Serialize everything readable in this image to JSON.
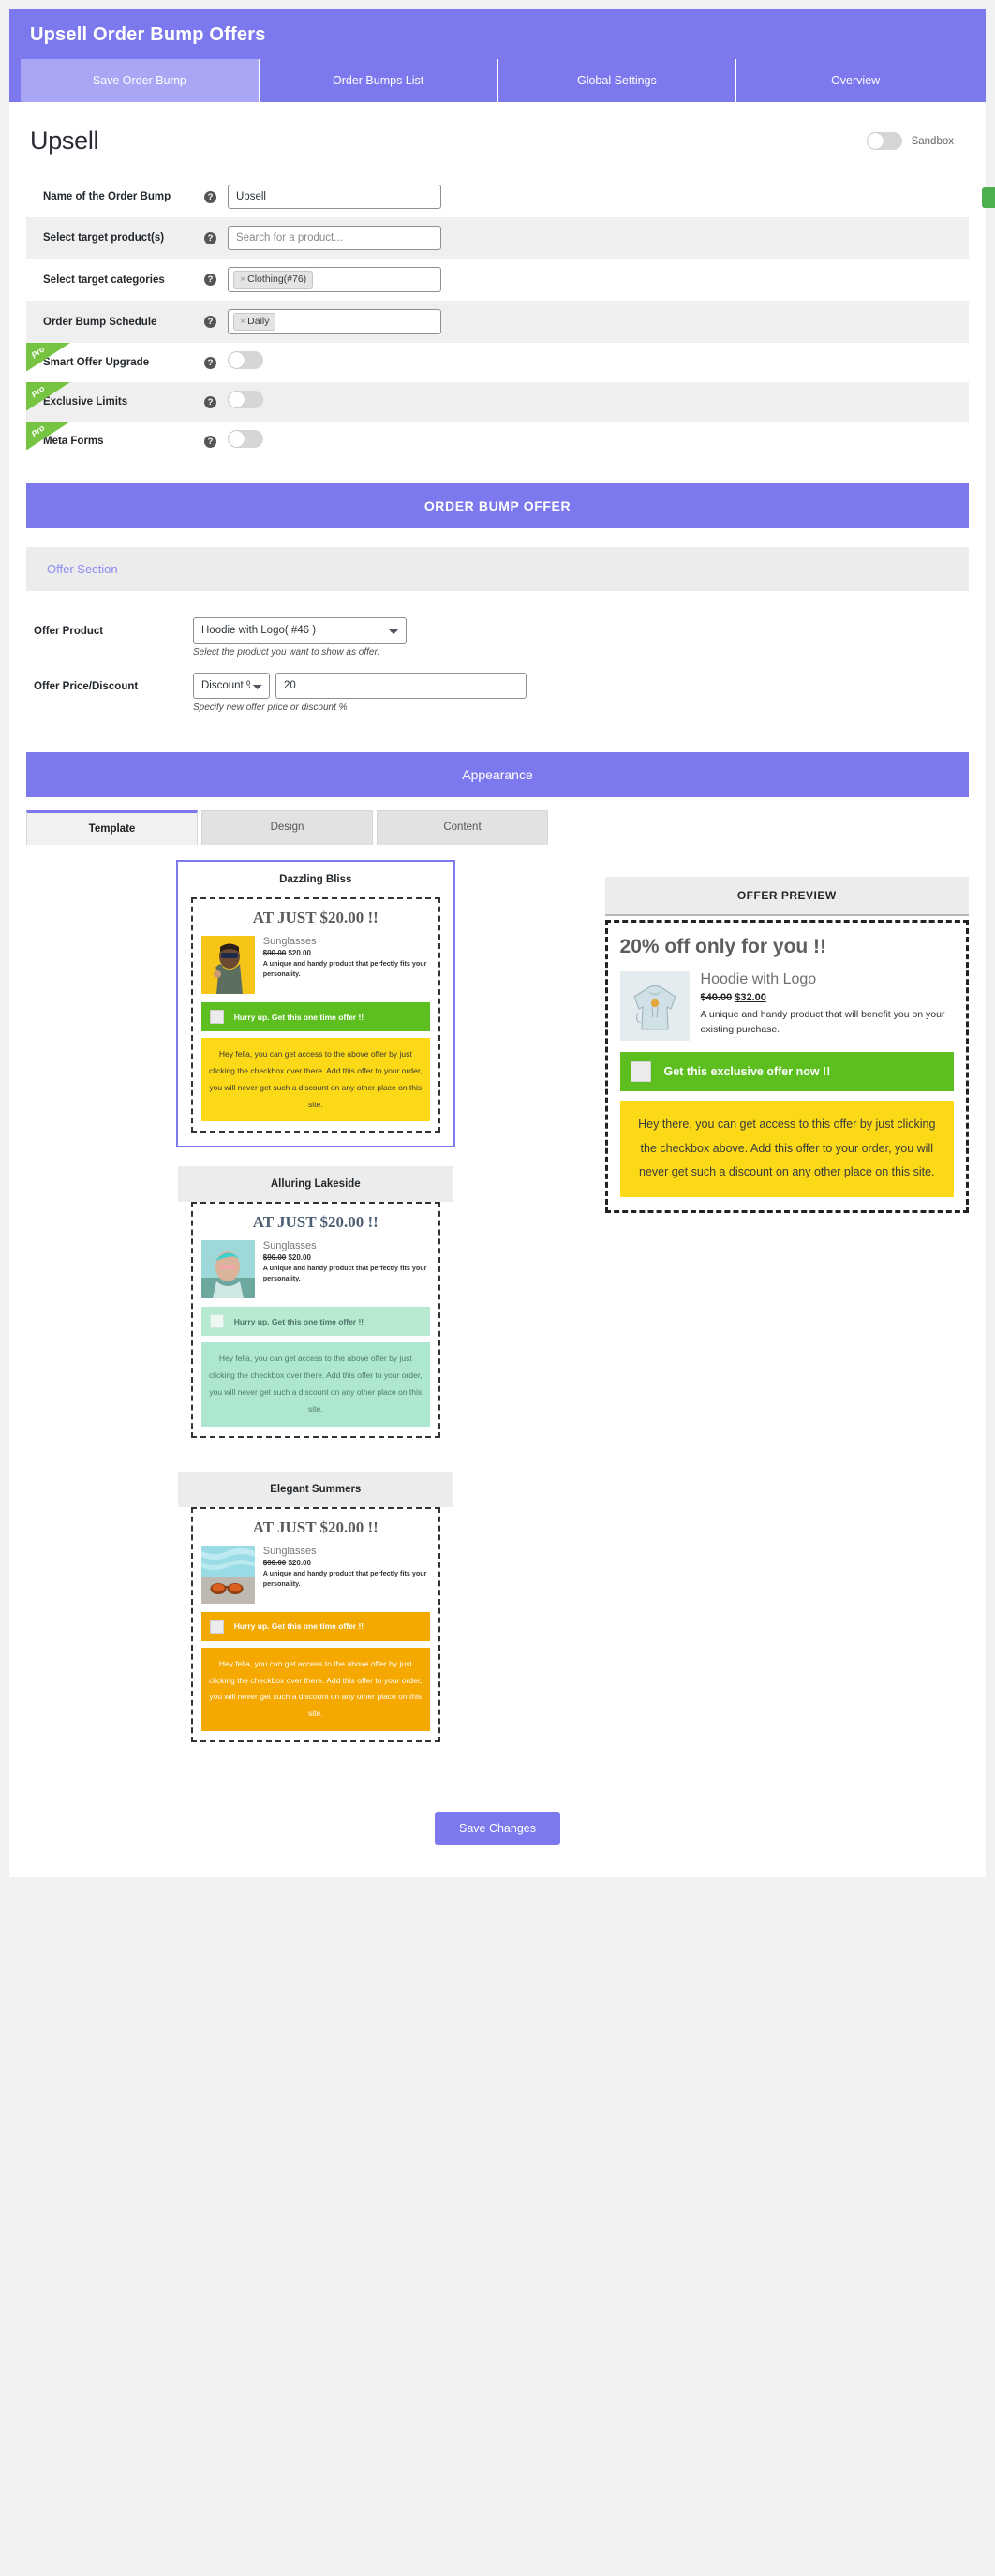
{
  "header": {
    "app_title": "Upsell Order Bump Offers",
    "tabs": [
      {
        "label": "Save Order Bump",
        "active": true
      },
      {
        "label": "Order Bumps List",
        "active": false
      },
      {
        "label": "Global Settings",
        "active": false
      },
      {
        "label": "Overview",
        "active": false
      }
    ]
  },
  "page": {
    "title": "Upsell",
    "sandbox_label": "Sandbox",
    "sandbox_on": false
  },
  "form": {
    "rows": [
      {
        "label": "Name of the Order Bump",
        "type": "text",
        "value": "Upsell",
        "placeholder": "",
        "help": "?"
      },
      {
        "label": "Select target product(s)",
        "type": "text",
        "value": "",
        "placeholder": "Search for a product...",
        "help": "?"
      },
      {
        "label": "Select target categories",
        "type": "token",
        "token": "Clothing(#76)",
        "token_remove": "×",
        "help": "?"
      },
      {
        "label": "Order Bump Schedule",
        "type": "token",
        "token": "Daily",
        "token_remove": "×",
        "help": "?"
      },
      {
        "label": "Smart Offer Upgrade",
        "type": "toggle",
        "pro": "Pro",
        "toggle_on": false,
        "help": "?"
      },
      {
        "label": "Exclusive Limits",
        "type": "toggle",
        "pro": "Pro",
        "toggle_on": false,
        "help": "?"
      },
      {
        "label": "Meta Forms",
        "type": "toggle",
        "pro": "Pro",
        "toggle_on": false,
        "help": "?"
      }
    ]
  },
  "offer": {
    "banner": "ORDER BUMP OFFER",
    "subsection": "Offer Section",
    "product_label": "Offer Product",
    "product_value": "Hoodie with Logo( #46 )",
    "product_hint": "Select the product you want to show as offer.",
    "price_label": "Offer Price/Discount",
    "price_type_value": "Discount %",
    "price_value": "20",
    "price_hint": "Specify new offer price or discount %"
  },
  "appearance": {
    "banner": "Appearance",
    "tabs": [
      {
        "label": "Template",
        "active": true
      },
      {
        "label": "Design",
        "active": false
      },
      {
        "label": "Content",
        "active": false
      }
    ]
  },
  "templates": [
    {
      "name": "Dazzling Bliss",
      "theme": "theme-yellow",
      "selected": true,
      "gray_head": false,
      "headline": "AT JUST $20.00 !!",
      "product_name": "Sunglasses",
      "price_old": "$90.00",
      "price_new": "$20.00",
      "description": "A unique and handy product that perfectly fits your personality.",
      "cta": "Hurry up. Get this one time offer !!",
      "blurb": "Hey fella, you can get access to the above offer by just clicking the checkbox over there. Add this offer to your order, you will never get such a discount on any other place on this site."
    },
    {
      "name": "Alluring Lakeside",
      "theme": "theme-mint",
      "selected": false,
      "gray_head": true,
      "headline": "AT JUST $20.00 !!",
      "product_name": "Sunglasses",
      "price_old": "$90.00",
      "price_new": "$20.00",
      "description": "A unique and handy product that perfectly fits your personality.",
      "cta": "Hurry up. Get this one time offer !!",
      "blurb": "Hey fella, you can get access to the above offer by just clicking the checkbox over there. Add this offer to your order, you will never get such a discount on any other place on this site."
    },
    {
      "name": "Elegant Summers",
      "theme": "theme-orange",
      "selected": false,
      "gray_head": true,
      "headline": "AT JUST $20.00 !!",
      "product_name": "Sunglasses",
      "price_old": "$90.00",
      "price_new": "$20.00",
      "description": "A unique and handy product that perfectly fits your personality.",
      "cta": "Hurry up. Get this one time offer !!",
      "blurb": "Hey fella, you can get access to the above offer by just clicking the checkbox over there. Add this offer to your order, you will never get such a discount on any other place on this site."
    }
  ],
  "preview": {
    "title": "OFFER PREVIEW",
    "headline": "20% off only for you !!",
    "product_name": "Hoodie with Logo",
    "price_old": "$40.00",
    "price_new": "$32.00",
    "description": "A unique and handy product that will benefit you on your existing purchase.",
    "cta": "Get this exclusive offer now !!",
    "blurb": "Hey there, you can get access to this offer by just clicking the checkbox above. Add this offer to your order, you will never get such a discount on any other place on this site."
  },
  "footer": {
    "save_label": "Save Changes"
  },
  "colors": {
    "brand": "#7b79ed",
    "pro": "#76c442",
    "cta_green": "#5cbf1f",
    "yellow": "#fbd916",
    "mint": "#aee7cf",
    "orange": "#f5a800"
  }
}
